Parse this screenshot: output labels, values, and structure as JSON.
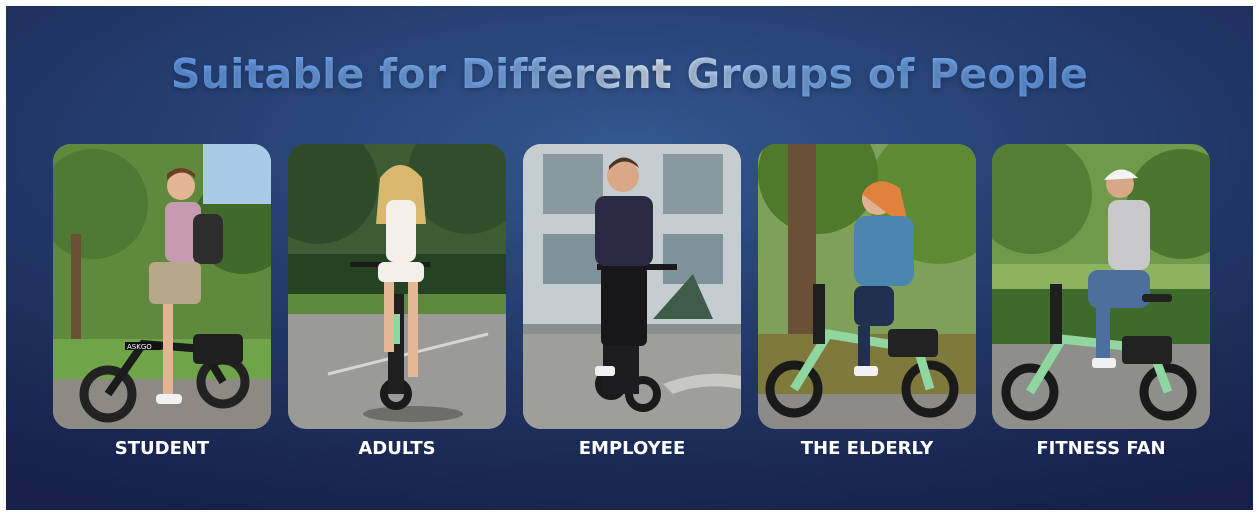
{
  "title": "Suitable for Different Groups of People",
  "groups": [
    {
      "label": "STUDENT",
      "photo": "student-riding-ebike-photo"
    },
    {
      "label": "ADULTS",
      "photo": "woman-riding-ebike-photo"
    },
    {
      "label": "EMPLOYEE",
      "photo": "man-riding-ebike-photo"
    },
    {
      "label": "THE ELDERLY",
      "photo": "elderly-woman-riding-ebike-photo"
    },
    {
      "label": "FITNESS FAN",
      "photo": "helmeted-woman-riding-ebike-photo"
    }
  ],
  "bike_brand": "ASKGO",
  "colors": {
    "background": "#1f3366",
    "title_gradient_start": "#5b97ee",
    "title_gradient_highlight": "#dbe9fb",
    "label": "#ffffff",
    "bike_accent_green": "#8fd6a1"
  }
}
